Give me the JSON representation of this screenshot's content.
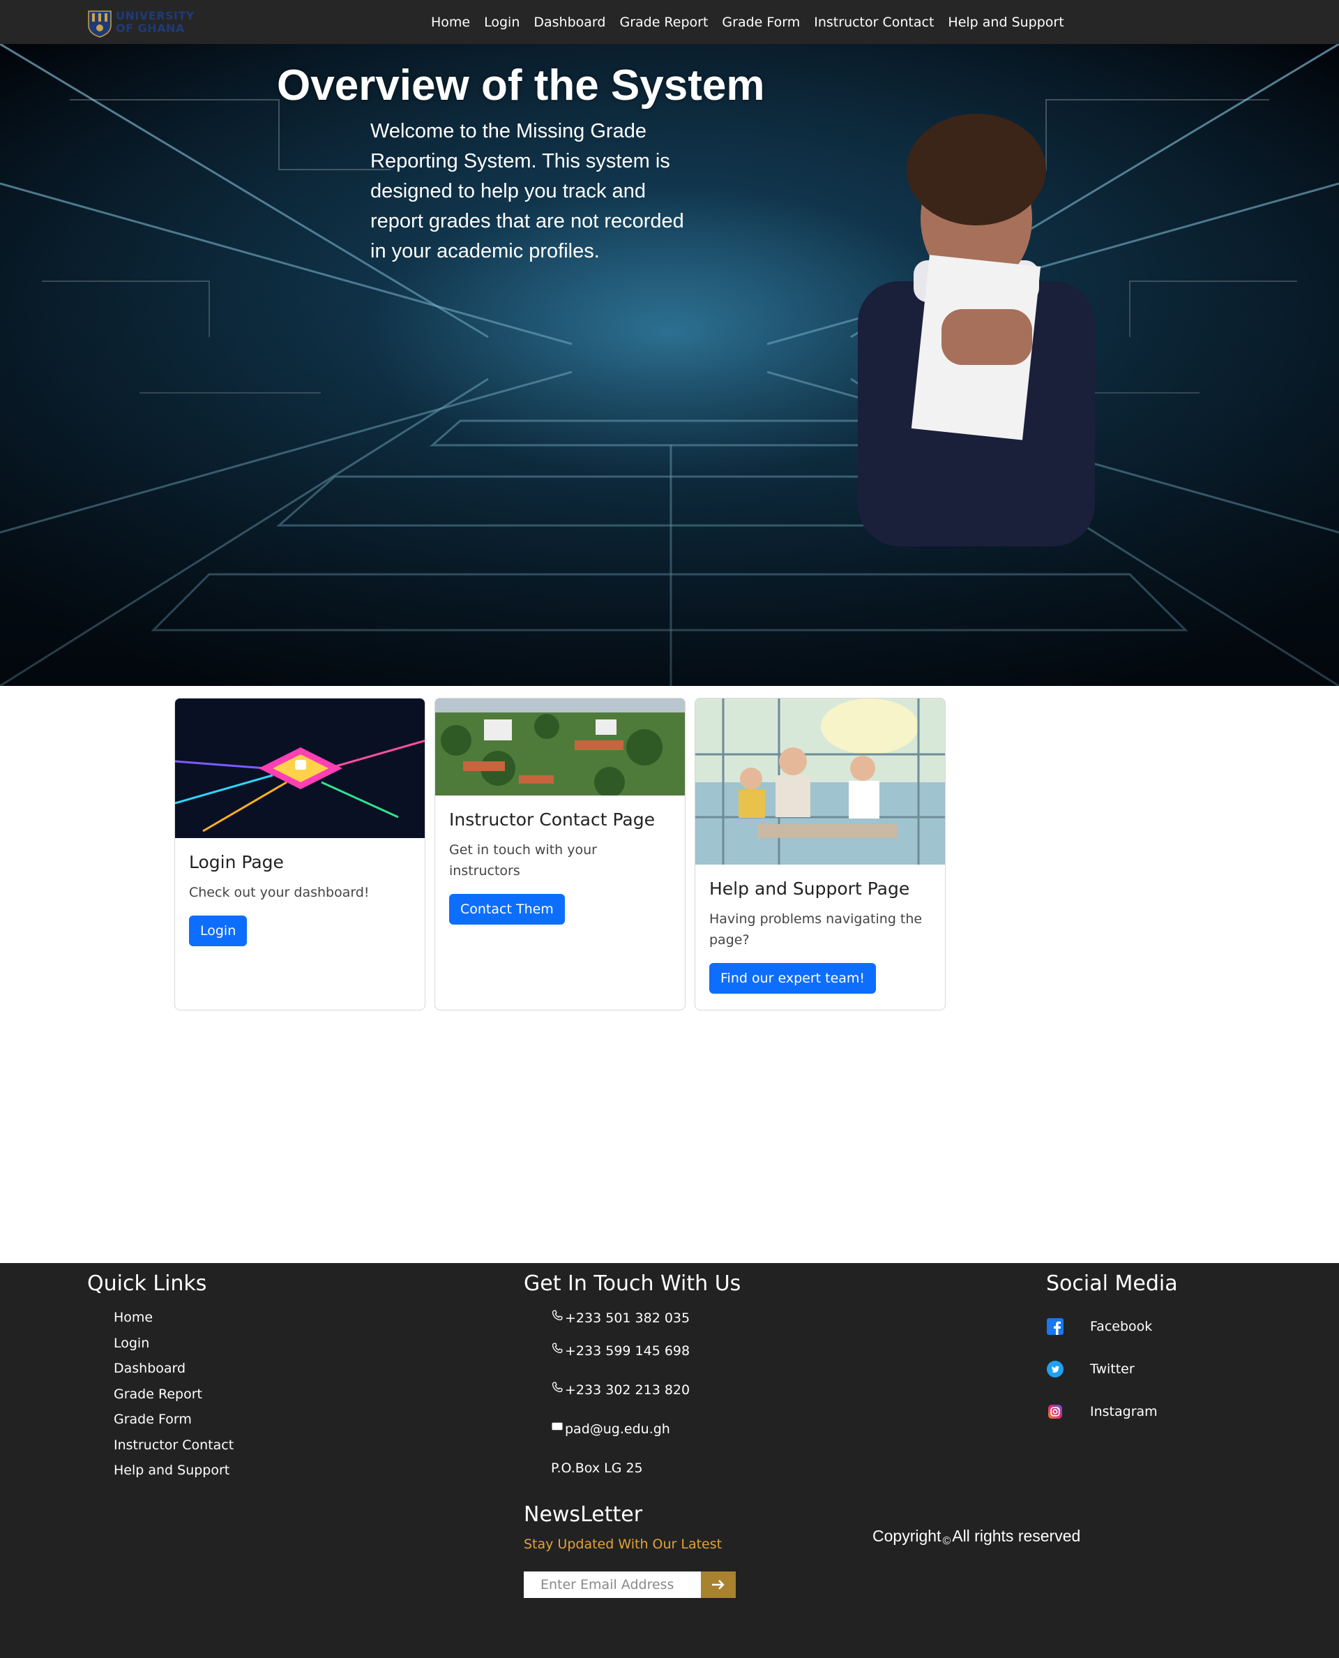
{
  "brand": {
    "line1": "UNIVERSITY",
    "line2": "OF GHANA",
    "logo_icon": "university-crest-icon"
  },
  "nav": {
    "items": [
      {
        "label": "Home"
      },
      {
        "label": "Login"
      },
      {
        "label": "Dashboard"
      },
      {
        "label": "Grade Report"
      },
      {
        "label": "Grade Form"
      },
      {
        "label": "Instructor Contact"
      },
      {
        "label": "Help and Support"
      }
    ]
  },
  "hero": {
    "title": "Overview of the System",
    "text": "Welcome to the Missing Grade Reporting System. This system is designed to help you track and report grades that are not recorded in your academic profiles."
  },
  "cards": [
    {
      "title": "Login Page",
      "text": "Check out your dashboard!",
      "button": "Login"
    },
    {
      "title": "Instructor Contact Page",
      "text": "Get in touch with your instructors",
      "button": "Contact Them"
    },
    {
      "title": "Help and Support Page",
      "text": "Having problems navigating the page?",
      "button": "Find our expert team!"
    }
  ],
  "footer": {
    "quick_links": {
      "heading": "Quick Links",
      "items": [
        "Home",
        "Login",
        "Dashboard",
        "Grade Report",
        "Grade Form",
        "Instructor Contact",
        "Help and Support"
      ]
    },
    "contact": {
      "heading": "Get In Touch With Us",
      "phones": [
        "+233 501 382 035",
        "+233 599 145 698",
        "+233 302 213 820"
      ],
      "email": "pad@ug.edu.gh",
      "address": "P.O.Box LG 25"
    },
    "newsletter": {
      "heading": "NewsLetter",
      "subtitle": "Stay Updated With Our Latest",
      "placeholder": "Enter Email Address",
      "submit_icon": "arrow-right-icon"
    },
    "social": {
      "heading": "Social Media",
      "items": [
        {
          "label": "Facebook",
          "icon": "facebook-icon",
          "color": "#1877f2"
        },
        {
          "label": "Twitter",
          "icon": "twitter-icon",
          "color": "#1da1f2"
        },
        {
          "label": "Instagram",
          "icon": "instagram-icon",
          "color": "#c13584"
        }
      ]
    },
    "copyright": {
      "prefix": "Copyright",
      "symbol": "©",
      "suffix": "All rights reserved"
    }
  },
  "colors": {
    "navbar": "#262626",
    "footer": "#222222",
    "primary_button": "#0d6efd",
    "newsletter_accent": "#e0a43a",
    "newsletter_button": "#a9822f"
  }
}
